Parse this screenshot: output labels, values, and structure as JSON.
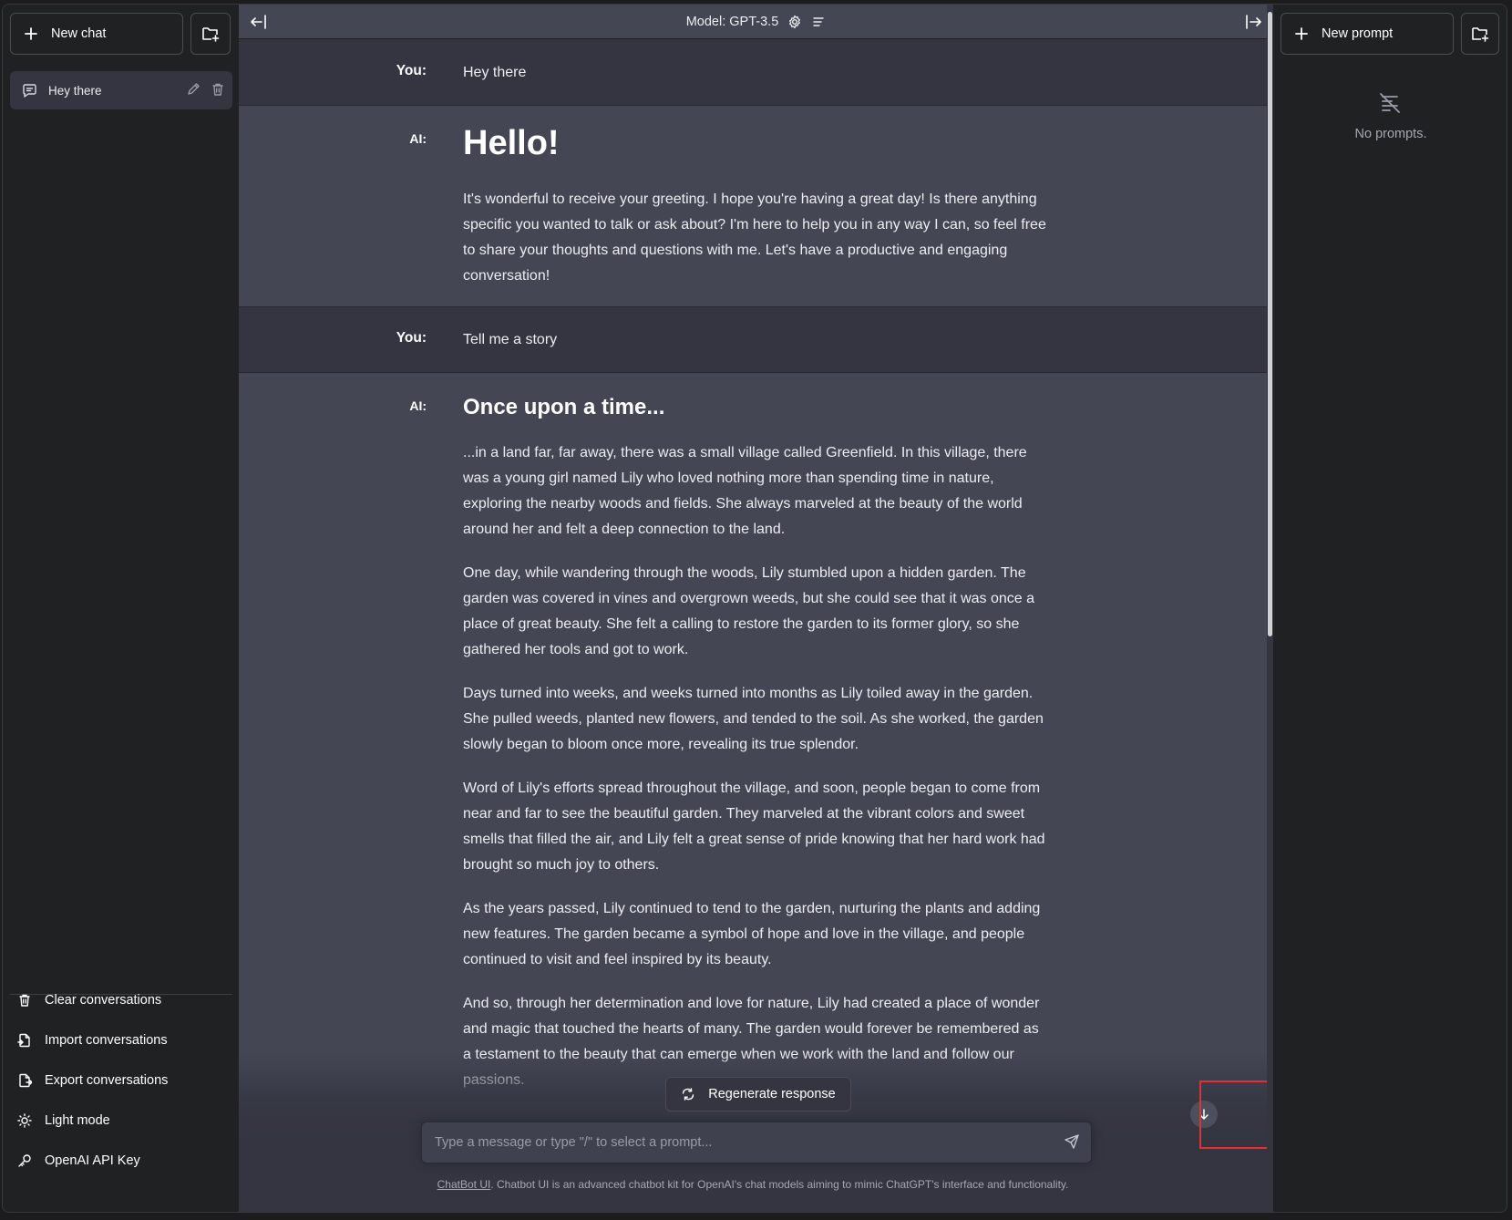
{
  "left_sidebar": {
    "new_chat_label": "New chat",
    "conversations": [
      {
        "title": "Hey there"
      }
    ],
    "footer": {
      "clear_label": "Clear conversations",
      "import_label": "Import conversations",
      "export_label": "Export conversations",
      "theme_label": "Light mode",
      "api_key_label": "OpenAI API Key"
    }
  },
  "topbar": {
    "model_label": "Model: GPT-3.5"
  },
  "messages": [
    {
      "role_label": "You:",
      "text": "Hey there"
    },
    {
      "role_label": "AI:",
      "heading": "Hello!",
      "paragraphs": [
        "It's wonderful to receive your greeting. I hope you're having a great day! Is there anything specific you wanted to talk or ask about? I'm here to help you in any way I can, so feel free to share your thoughts and questions with me. Let's have a productive and engaging conversation!"
      ]
    },
    {
      "role_label": "You:",
      "text": "Tell me a story"
    },
    {
      "role_label": "AI:",
      "heading": "Once upon a time...",
      "paragraphs": [
        "...in a land far, far away, there was a small village called Greenfield. In this village, there was a young girl named Lily who loved nothing more than spending time in nature, exploring the nearby woods and fields. She always marveled at the beauty of the world around her and felt a deep connection to the land.",
        "One day, while wandering through the woods, Lily stumbled upon a hidden garden. The garden was covered in vines and overgrown weeds, but she could see that it was once a place of great beauty. She felt a calling to restore the garden to its former glory, so she gathered her tools and got to work.",
        "Days turned into weeks, and weeks turned into months as Lily toiled away in the garden. She pulled weeds, planted new flowers, and tended to the soil. As she worked, the garden slowly began to bloom once more, revealing its true splendor.",
        "Word of Lily's efforts spread throughout the village, and soon, people began to come from near and far to see the beautiful garden. They marveled at the vibrant colors and sweet smells that filled the air, and Lily felt a great sense of pride knowing that her hard work had brought so much joy to others.",
        "As the years passed, Lily continued to tend to the garden, nurturing the plants and adding new features. The garden became a symbol of hope and love in the village, and people continued to visit and feel inspired by its beauty.",
        "And so, through her determination and love for nature, Lily had created a place of wonder and magic that touched the hearts of many. The garden would forever be remembered as a testament to the beauty that can emerge when we work with the land and follow our passions."
      ]
    }
  ],
  "regenerate_label": "Regenerate response",
  "input": {
    "placeholder": "Type a message or type \"/\" to select a prompt..."
  },
  "disclaimer": {
    "link_text": "ChatBot UI",
    "text": ". Chatbot UI is an advanced chatbot kit for OpenAI's chat models aiming to mimic ChatGPT's interface and functionality."
  },
  "right_sidebar": {
    "new_prompt_label": "New prompt",
    "empty_text": "No prompts."
  },
  "colors": {
    "sidebar_bg": "#202123",
    "chat_bg": "#343541",
    "ai_message_bg": "#444654",
    "input_bg": "#40414f",
    "highlight": "#e0322f"
  },
  "icons": [
    "plus-icon",
    "folder-plus-icon",
    "chat-bubble-icon",
    "pencil-icon",
    "trash-icon",
    "file-import-icon",
    "file-export-icon",
    "sun-icon",
    "key-icon",
    "collapse-left-icon",
    "collapse-right-icon",
    "gear-icon",
    "menu-lines-icon",
    "refresh-icon",
    "send-icon",
    "arrow-down-icon",
    "no-prompts-icon"
  ]
}
